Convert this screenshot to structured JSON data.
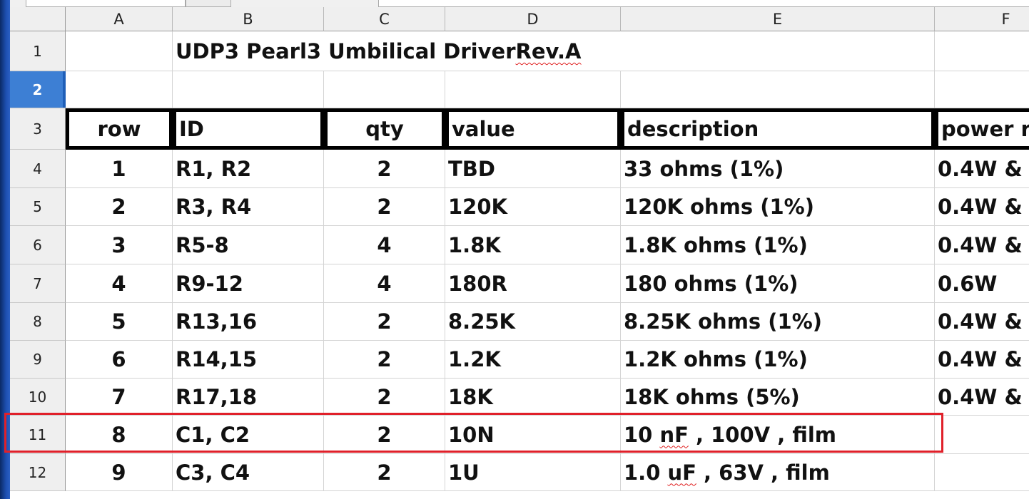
{
  "columns": [
    "A",
    "B",
    "C",
    "D",
    "E",
    "F"
  ],
  "row_numbers": [
    "1",
    "2",
    "3",
    "4",
    "5",
    "6",
    "7",
    "8",
    "9",
    "10",
    "11",
    "12"
  ],
  "title": {
    "part1": "UDP3 Pearl3 Umbilical Driver  ",
    "part2": "Rev.A"
  },
  "headers": {
    "row": "row",
    "id": "ID",
    "qty": "qty",
    "value": "value",
    "description": "description",
    "power": "power r"
  },
  "rows": [
    {
      "row": "1",
      "id": "R1, R2",
      "qty": "2",
      "value": "TBD",
      "desc": "33 ohms (1%)",
      "power": "0.4W &"
    },
    {
      "row": "2",
      "id": "R3, R4",
      "qty": "2",
      "value": "120K",
      "desc": "120K ohms (1%)",
      "power": "0.4W &"
    },
    {
      "row": "3",
      "id": "R5-8",
      "qty": "4",
      "value": "1.8K",
      "desc": "1.8K ohms (1%)",
      "power": "0.4W &"
    },
    {
      "row": "4",
      "id": "R9-12",
      "qty": "4",
      "value": "180R",
      "desc": "180 ohms (1%)",
      "power": "0.6W"
    },
    {
      "row": "5",
      "id": "R13,16",
      "qty": "2",
      "value": "8.25K",
      "desc": "8.25K ohms (1%)",
      "power": "0.4W &"
    },
    {
      "row": "6",
      "id": "R14,15",
      "qty": "2",
      "value": "1.2K",
      "desc": "1.2K ohms (1%)",
      "power": "0.4W &"
    },
    {
      "row": "7",
      "id": "R17,18",
      "qty": "2",
      "value": "18K",
      "desc": "18K ohms (5%)",
      "power": "0.4W &"
    },
    {
      "row": "8",
      "id": "C1, C2",
      "qty": "2",
      "value": "10N",
      "desc_pre": "10 ",
      "desc_sq": "nF",
      "desc_post": " , 100V , film",
      "power": ""
    },
    {
      "row": "9",
      "id": "C3, C4",
      "qty": "2",
      "value": "1U",
      "desc_pre": "1.0 ",
      "desc_sq": "uF",
      "desc_post": " , 63V , film",
      "power": ""
    }
  ],
  "active_row": "2",
  "highlight_color": "#e0202a",
  "selection_color": "#3d7fd4"
}
